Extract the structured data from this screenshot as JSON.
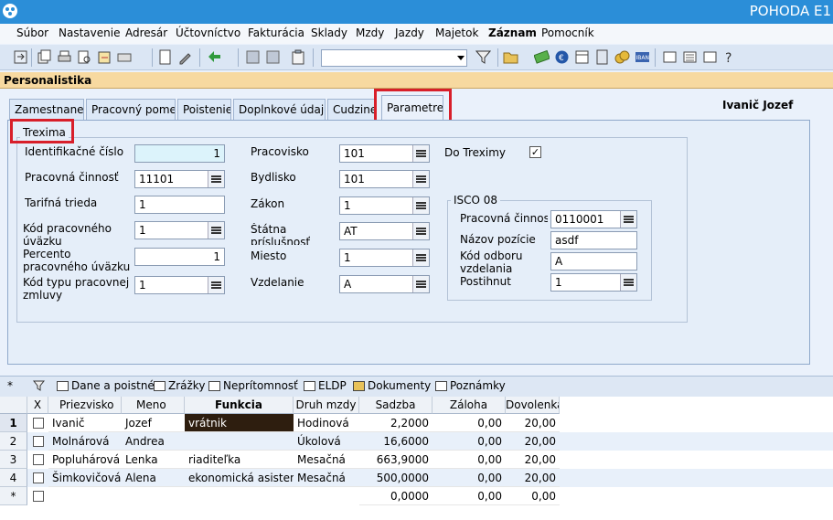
{
  "window": {
    "title": "POHODA E1"
  },
  "menu": [
    "Súbor",
    "Nastavenie",
    "Adresár",
    "Účtovníctvo",
    "Fakturácia",
    "Sklady",
    "Mzdy",
    "Jazdy",
    "Majetok",
    "Záznam",
    "Pomocník"
  ],
  "toolbar": {
    "combo_value": ""
  },
  "section": {
    "title": "Personalistika"
  },
  "tabs": [
    "Zamestnanec",
    "Pracovný pomer",
    "Poistenie",
    "Doplnkové údaje",
    "Cudzinec",
    "Parametre"
  ],
  "employee_name": "Ivanič Jozef",
  "form": {
    "group_title": "Trexima",
    "id_number": {
      "label": "Identifikačné číslo",
      "value": "1"
    },
    "work_activity": {
      "label": "Pracovná činnosť",
      "value": "11101"
    },
    "tariff_class": {
      "label": "Tarifná trieda",
      "value": "1"
    },
    "workload_code": {
      "label": "Kód pracovného úväzku",
      "value": "1"
    },
    "workload_percent": {
      "label": "Percento pracovného úväzku",
      "value": "1"
    },
    "contract_type": {
      "label": "Kód typu pracovnej zmluvy",
      "value": "1"
    },
    "workplace": {
      "label": "Pracovisko",
      "value": "101"
    },
    "residence": {
      "label": "Bydlisko",
      "value": "101"
    },
    "law": {
      "label": "Zákon",
      "value": "1"
    },
    "citizenship": {
      "label": "Štátna príslušnosť",
      "value": "AT"
    },
    "place": {
      "label": "Miesto",
      "value": "1"
    },
    "education": {
      "label": "Vzdelanie",
      "value": "A"
    },
    "do_trexima": {
      "label": "Do Treximy",
      "checked": true,
      "mark": "✓"
    },
    "isco": {
      "title": "ISCO 08",
      "work_activity": {
        "label": "Pracovná činnosť",
        "value": "0110001"
      },
      "position_name": {
        "label": "Názov pozície",
        "value": "asdf"
      },
      "field_code": {
        "label": "Kód odboru vzdelania",
        "value": "A"
      },
      "disability": {
        "label": "Postihnutie",
        "value": "1"
      }
    }
  },
  "bottom_tabs": [
    "Dane a poistné",
    "Zrážky",
    "Neprítomnosť",
    "ELDP",
    "Dokumenty",
    "Poznámky"
  ],
  "grid": {
    "columns": [
      "X",
      "Priezvisko",
      "Meno",
      "Funkcia",
      "Druh mzdy",
      "Sadzba",
      "Záloha",
      "Dovolenka"
    ],
    "rows": [
      {
        "n": "1",
        "surname": "Ivanič",
        "name": "Jozef",
        "function": "vrátnik",
        "wage_type": "Hodinová",
        "rate": "2,2000",
        "advance": "0,00",
        "leave": "20,00"
      },
      {
        "n": "2",
        "surname": "Molnárová",
        "name": "Andrea",
        "function": "",
        "wage_type": "Úkolová",
        "rate": "16,6000",
        "advance": "0,00",
        "leave": "20,00"
      },
      {
        "n": "3",
        "surname": "Popluhárová",
        "name": "Lenka",
        "function": "riaditeľka",
        "wage_type": "Mesačná",
        "rate": "663,9000",
        "advance": "0,00",
        "leave": "20,00"
      },
      {
        "n": "4",
        "surname": "Šimkovičová",
        "name": "Alena",
        "function": "ekonomická asistent",
        "wage_type": "Mesačná",
        "rate": "500,0000",
        "advance": "0,00",
        "leave": "20,00"
      }
    ],
    "new_row": {
      "n": "*",
      "rate": "0,0000",
      "advance": "0,00",
      "leave": "0,00"
    },
    "star": "*"
  },
  "colors": {
    "titlebar": "#2b8ed8",
    "section": "#f7d9a0",
    "highlight": "#d81f2a",
    "selected_cell": "#2e1e0f"
  }
}
